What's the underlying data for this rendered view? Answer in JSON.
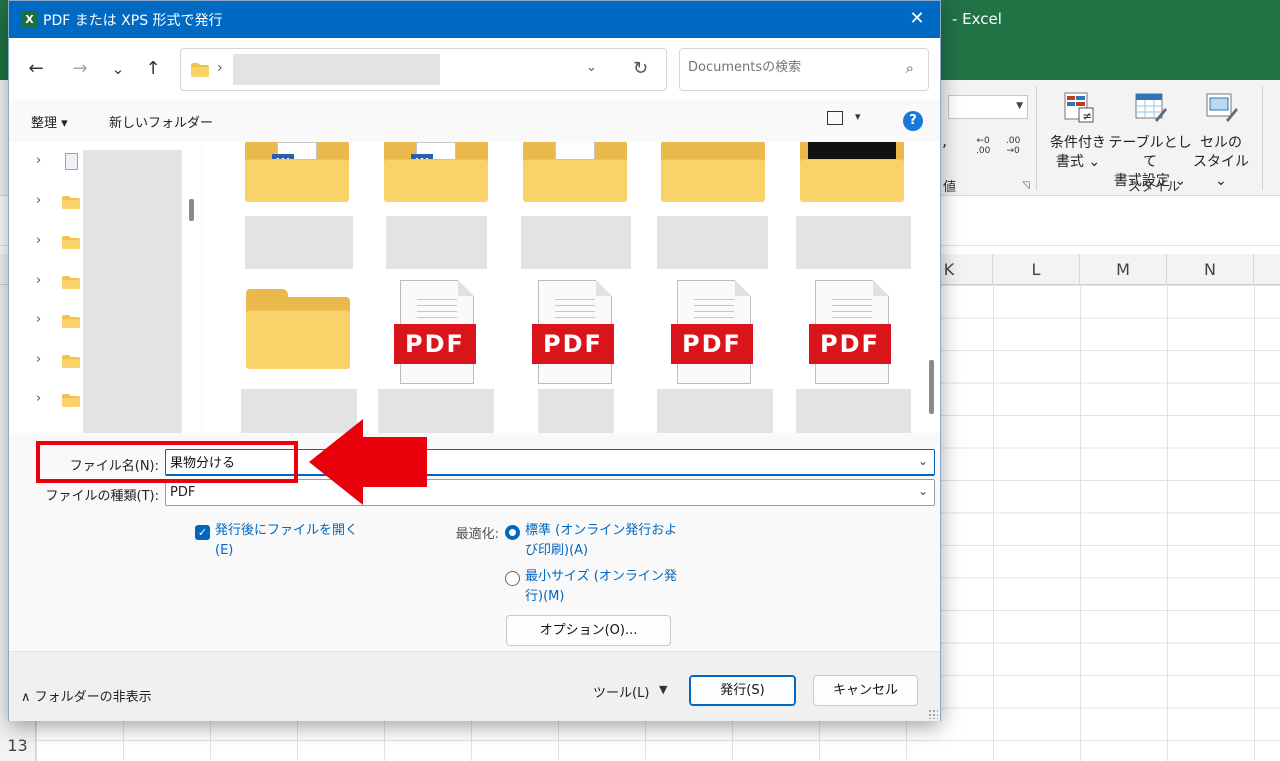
{
  "excel": {
    "app_title": "-  Excel",
    "ribbon": {
      "style_group_label": "スタイル",
      "group_label_partial": "値",
      "conditional_format": {
        "line1": "条件付き",
        "line2": "書式 ⌄"
      },
      "format_as_table": {
        "line1": "テーブルとして",
        "line2": "書式設定 ⌄"
      },
      "cell_styles": {
        "line1": "セルの",
        "line2": "スタイル ⌄"
      },
      "decimal_increase": "←0\n.00",
      "decimal_decrease": ".00\n→0",
      "comma": ","
    },
    "columns": [
      "K",
      "L",
      "M",
      "N"
    ],
    "visible_row_number": "13"
  },
  "dialog": {
    "title": "PDF または XPS 形式で発行",
    "app_icon_letter": "X",
    "close_glyph": "✕",
    "nav": {
      "back_glyph": "←",
      "forward_glyph": "→",
      "recent_glyph": "⌄",
      "up_glyph": "↑",
      "address_separator": "›",
      "address_dropdown_glyph": "⌄",
      "refresh_glyph": "↻",
      "search_placeholder": "Documentsの検索",
      "search_glyph": "⌕"
    },
    "toolbar": {
      "organize": "整理 ▾",
      "new_folder": "新しいフォルダー",
      "view_caret": "▾",
      "help": "?"
    },
    "tree_chevron": "›",
    "pdf_label": "PDF",
    "word_badge": "W",
    "form": {
      "filename_label": "ファイル名(N):",
      "filename_value": "果物分ける",
      "filetype_label": "ファイルの種類(T):",
      "filetype_value": "PDF",
      "caret": "⌄",
      "open_after_publish": {
        "line1": "発行後にファイルを開く",
        "line2": "(E)",
        "checked": true,
        "check_glyph": "✓"
      },
      "optimize_label": "最適化:",
      "optimize_standard": {
        "line1": "標準 (オンライン発行およ",
        "line2": "び印刷)(A)",
        "selected": true
      },
      "optimize_minimum": {
        "line1": "最小サイズ (オンライン発",
        "line2": "行)(M)",
        "selected": false
      },
      "options_button": "オプション(O)..."
    },
    "footer": {
      "hide_folders": "∧  フォルダーの非表示",
      "tools": "ツール(L)",
      "tools_caret": "▼",
      "publish_button": "発行(S)",
      "cancel_button": "キャンセル"
    }
  },
  "colors": {
    "excel_green": "#217346",
    "dialog_title_blue": "#0069c2",
    "accent_blue": "#0067c0",
    "callout_red": "#e8000b",
    "pdf_red": "#d9141b",
    "folder_yellow": "#f9d26a"
  }
}
